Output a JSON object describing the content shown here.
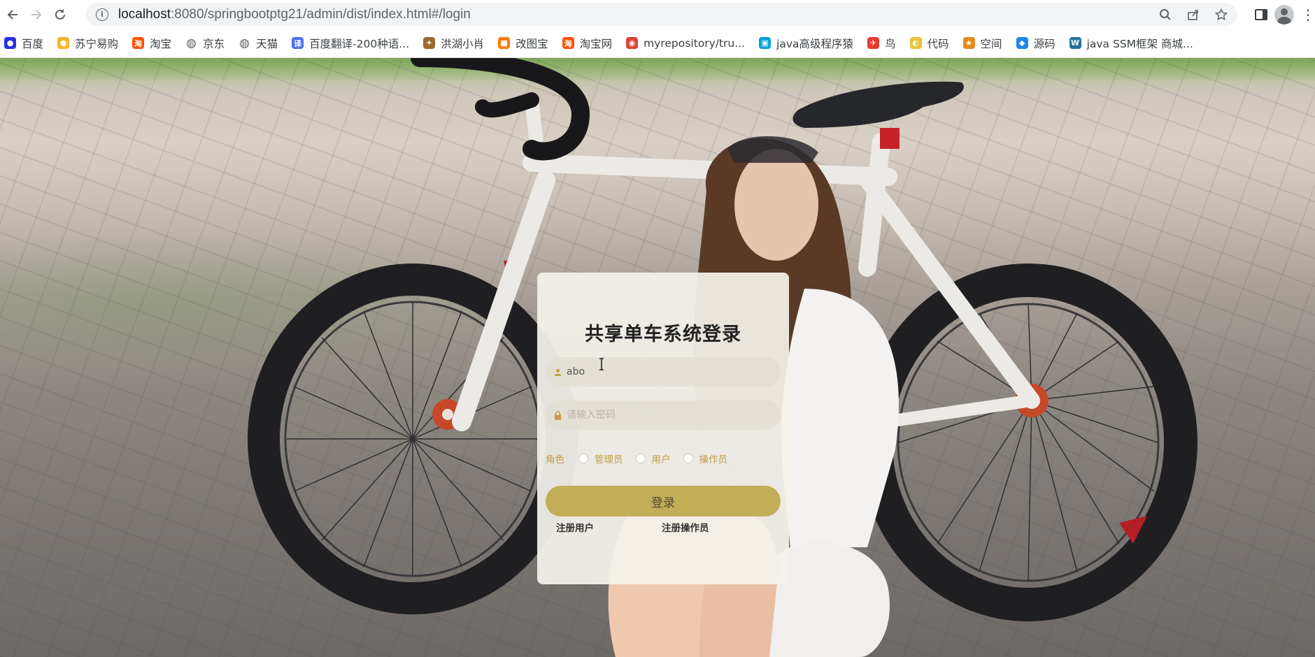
{
  "browser": {
    "url_host": "localhost",
    "url_rest": ":8080/springbootptg21/admin/dist/index.html#/login",
    "bookmarks": [
      {
        "label": "百度",
        "icon": "baidu-paw-icon",
        "color": "#2932e1"
      },
      {
        "label": "苏宁易购",
        "icon": "suning-lion-icon",
        "color": "#f7b52c"
      },
      {
        "label": "淘宝",
        "icon": "taobao-icon",
        "color": "#ff5000"
      },
      {
        "label": "京东",
        "icon": "globe-icon",
        "color": "#5f6368"
      },
      {
        "label": "天猫",
        "icon": "globe-icon",
        "color": "#5f6368"
      },
      {
        "label": "百度翻译-200种语...",
        "icon": "translate-icon",
        "color": "#4e6ef2"
      },
      {
        "label": "洪湖小肖",
        "icon": "bird-icon",
        "color": "#9b6a2d"
      },
      {
        "label": "改图宝",
        "icon": "gaitubao-icon",
        "color": "#ff7a00"
      },
      {
        "label": "淘宝网",
        "icon": "taobao-icon",
        "color": "#ff5000"
      },
      {
        "label": "myrepository/tru...",
        "icon": "chrome-icon",
        "color": "#db4437"
      },
      {
        "label": "java高级程序猿",
        "icon": "bilibili-icon",
        "color": "#00a1d6"
      },
      {
        "label": "鸟",
        "icon": "swift-bird-icon",
        "color": "#e63b2e"
      },
      {
        "label": "代码",
        "icon": "moon-icon",
        "color": "#e8c33a"
      },
      {
        "label": "空间",
        "icon": "qzone-icon",
        "color": "#e38a1c"
      },
      {
        "label": "源码",
        "icon": "fish-icon",
        "color": "#1e88e5"
      },
      {
        "label": "java SSM框架 商城...",
        "icon": "wordpress-icon",
        "color": "#21759b"
      }
    ]
  },
  "login": {
    "title": "共享单车系统登录",
    "username_value": "abo",
    "password_placeholder": "请输入密码",
    "role_label": "角色",
    "roles": [
      "管理员",
      "用户",
      "操作员"
    ],
    "login_button": "登录",
    "register_user": "注册用户",
    "register_operator": "注册操作员"
  }
}
